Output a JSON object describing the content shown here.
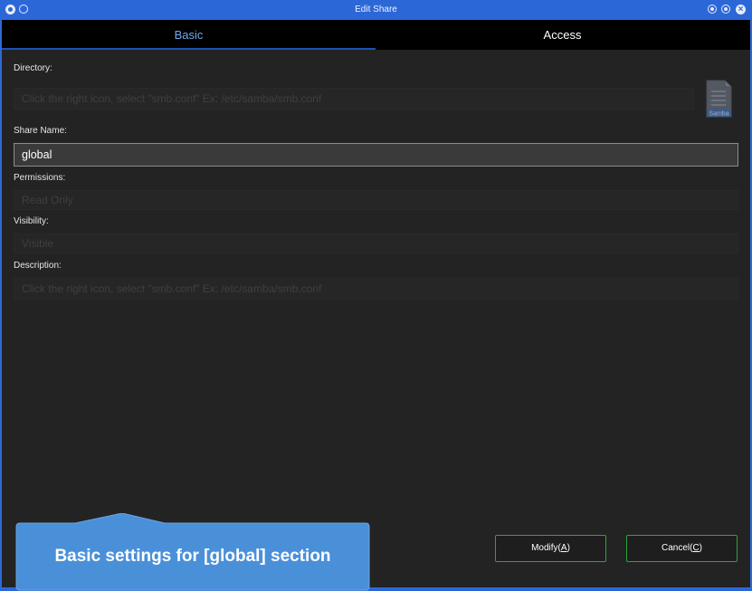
{
  "window": {
    "title": "Edit Share"
  },
  "tabs": [
    {
      "label": "Basic",
      "active": true
    },
    {
      "label": "Access",
      "active": false
    }
  ],
  "form": {
    "directory": {
      "label": "Directory:",
      "value": "",
      "placeholder": "Click the right icon, select \"smb.conf\" Ex: /etc/samba/smb.conf"
    },
    "share_name": {
      "label": "Share Name:",
      "value": "global"
    },
    "permissions": {
      "label": "Permissions:",
      "value": "Read Only"
    },
    "visibility": {
      "label": "Visibility:",
      "value": "Visible"
    },
    "description": {
      "label": "Description:",
      "value": "",
      "placeholder": "Click the right icon, select \"smb.conf\" Ex: /etc/samba/smb.conf"
    },
    "samba_icon": {
      "name": "samba-file-icon",
      "caption": "Samba"
    }
  },
  "callout": {
    "text": "Basic settings for [global] section",
    "color": "#4a90d9"
  },
  "buttons": {
    "modify": {
      "label": "Modify(",
      "mnemonic": "A",
      "suffix": ")"
    },
    "cancel": {
      "label": "Cancel(",
      "mnemonic": "C",
      "suffix": ")"
    },
    "border_color": "#2ea43a"
  },
  "colors": {
    "titlebar": "#2c67d8",
    "background": "#232323",
    "tab_active": "#6fa7f2"
  }
}
